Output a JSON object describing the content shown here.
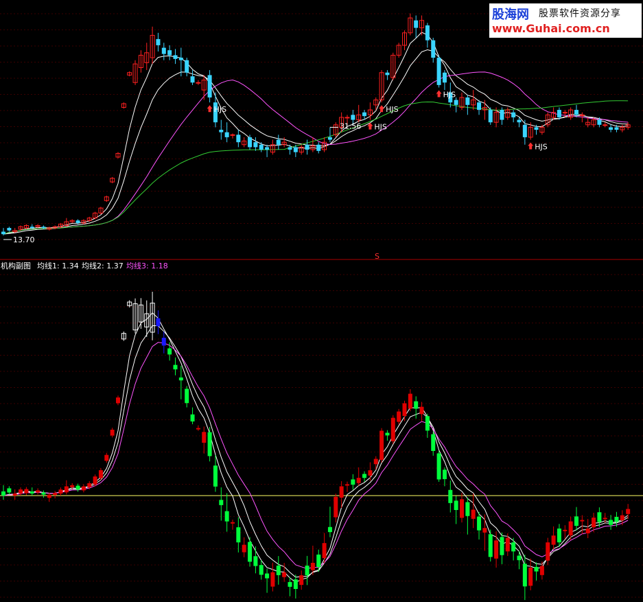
{
  "watermark": {
    "brand": "股海网",
    "slogan": "股票软件资源分享",
    "url": "www.Guhai.com.cn"
  },
  "colors": {
    "up": "#ff2020",
    "down": "#3ad4ff",
    "strong_up": "#e00000",
    "strong_down": "#00ff3c",
    "top_up": "#ffffff",
    "top_down": "#1a1aff",
    "ma1": "#ffffff",
    "ma2": "#ffffff",
    "ma3": "#ff55ff",
    "ma_long": "#33cc33",
    "divider": "#aa0000",
    "baseline": "#ffff66",
    "grid": "#7a0000",
    "text": "#ffffff"
  },
  "chart_data": [
    {
      "type": "candlestick",
      "pane": "price",
      "annotations": [
        {
          "text": "31.56",
          "x": 57,
          "kind": "high"
        },
        {
          "text": "13.70",
          "x": 0,
          "kind": "low"
        },
        {
          "text": "HJS",
          "x": 36,
          "kind": "signal"
        },
        {
          "text": "HJS",
          "x": 64,
          "kind": "signal"
        },
        {
          "text": "HJS",
          "x": 66,
          "kind": "signal"
        },
        {
          "text": "HJS",
          "x": 76,
          "kind": "signal"
        },
        {
          "text": "HJS",
          "x": 92,
          "kind": "signal"
        }
      ],
      "candles": [
        [
          14.0,
          13.8,
          14.3,
          13.7
        ],
        [
          14.3,
          14.1,
          14.4,
          14.0
        ],
        [
          14.0,
          14.1,
          14.3,
          13.9
        ],
        [
          14.2,
          14.4,
          14.5,
          14.1
        ],
        [
          14.3,
          14.5,
          14.6,
          14.2
        ],
        [
          14.4,
          14.3,
          14.6,
          14.2
        ],
        [
          14.4,
          14.5,
          14.6,
          14.3
        ],
        [
          14.4,
          14.3,
          14.5,
          14.2
        ],
        [
          14.2,
          14.3,
          14.4,
          14.1
        ],
        [
          14.3,
          14.4,
          14.5,
          14.2
        ],
        [
          14.4,
          14.6,
          14.7,
          14.3
        ],
        [
          14.5,
          14.8,
          15.1,
          14.4
        ],
        [
          14.8,
          14.9,
          15.0,
          14.7
        ],
        [
          14.9,
          14.7,
          15.0,
          14.6
        ],
        [
          14.7,
          14.9,
          15.0,
          14.6
        ],
        [
          14.9,
          15.1,
          15.2,
          14.8
        ],
        [
          15.1,
          15.5,
          15.6,
          15.0
        ],
        [
          15.5,
          15.9,
          16.0,
          15.4
        ],
        [
          16.5,
          16.8,
          16.9,
          16.4
        ],
        [
          18.0,
          18.3,
          18.4,
          17.9
        ],
        [
          20.0,
          20.3,
          20.4,
          19.9
        ],
        [
          24.0,
          24.3,
          24.4,
          23.9
        ],
        [
          26.6,
          26.8,
          26.9,
          26.5
        ],
        [
          26.0,
          27.5,
          27.8,
          25.8
        ],
        [
          27.2,
          28.2,
          28.6,
          26.8
        ],
        [
          27.6,
          28.4,
          29.2,
          27.0
        ],
        [
          28.0,
          29.8,
          30.5,
          27.5
        ],
        [
          29.5,
          29.0,
          30.0,
          28.5
        ],
        [
          28.8,
          28.3,
          29.2,
          27.8
        ],
        [
          28.6,
          28.2,
          29.0,
          27.8
        ],
        [
          28.2,
          27.9,
          28.7,
          27.5
        ],
        [
          28.0,
          27.8,
          28.8,
          26.5
        ],
        [
          27.8,
          26.8,
          28.0,
          26.5
        ],
        [
          26.5,
          26.0,
          27.0,
          25.8
        ],
        [
          26.0,
          26.0,
          26.2,
          25.8
        ],
        [
          25.4,
          26.2,
          26.6,
          24.6
        ],
        [
          26.6,
          24.8,
          27.0,
          24.4
        ],
        [
          24.4,
          22.8,
          25.2,
          22.4
        ],
        [
          22.2,
          22.0,
          23.0,
          21.4
        ],
        [
          22.0,
          21.6,
          22.8,
          21.2
        ],
        [
          21.8,
          21.8,
          21.9,
          21.5
        ],
        [
          21.8,
          21.2,
          22.2,
          20.8
        ],
        [
          21.0,
          21.3,
          21.6,
          20.8
        ],
        [
          21.6,
          20.8,
          21.8,
          20.6
        ],
        [
          21.2,
          20.8,
          21.6,
          20.5
        ],
        [
          21.0,
          20.6,
          21.2,
          20.4
        ],
        [
          20.8,
          20.6,
          21.0,
          20.0
        ],
        [
          20.4,
          21.0,
          21.4,
          20.2
        ],
        [
          21.4,
          21.0,
          21.8,
          20.6
        ],
        [
          21.0,
          21.2,
          21.6,
          20.8
        ],
        [
          20.8,
          20.6,
          21.0,
          20.2
        ],
        [
          20.8,
          20.4,
          21.0,
          20.0
        ],
        [
          20.4,
          20.8,
          21.0,
          20.2
        ],
        [
          21.0,
          20.6,
          21.4,
          20.2
        ],
        [
          20.6,
          20.9,
          21.6,
          20.4
        ],
        [
          21.0,
          20.5,
          21.2,
          20.3
        ],
        [
          20.6,
          21.2,
          21.6,
          20.4
        ],
        [
          21.6,
          21.4,
          22.4,
          21.2
        ],
        [
          21.8,
          22.6,
          22.8,
          21.6
        ],
        [
          22.4,
          23.2,
          23.6,
          22.0
        ],
        [
          23.2,
          23.2,
          23.4,
          22.6
        ],
        [
          23.4,
          23.0,
          23.8,
          22.6
        ],
        [
          23.0,
          23.4,
          24.2,
          22.8
        ],
        [
          23.6,
          23.3,
          23.8,
          23.0
        ],
        [
          23.4,
          23.8,
          24.4,
          23.0
        ],
        [
          24.2,
          24.6,
          24.8,
          23.8
        ],
        [
          24.6,
          26.8,
          27.0,
          24.4
        ],
        [
          26.8,
          26.6,
          27.0,
          26.2
        ],
        [
          26.4,
          28.2,
          28.4,
          26.2
        ],
        [
          28.2,
          29.0,
          29.2,
          28.0
        ],
        [
          29.0,
          30.0,
          30.2,
          28.6
        ],
        [
          30.0,
          31.2,
          31.56,
          29.8
        ],
        [
          31.0,
          30.4,
          31.4,
          29.6
        ],
        [
          30.4,
          31.0,
          31.4,
          29.8
        ],
        [
          30.6,
          29.4,
          30.8,
          28.8
        ],
        [
          29.4,
          28.0,
          29.6,
          27.6
        ],
        [
          28.0,
          25.8,
          28.2,
          25.6
        ],
        [
          26.8,
          26.0,
          27.0,
          25.4
        ],
        [
          25.2,
          24.4,
          26.0,
          24.0
        ],
        [
          24.6,
          24.2,
          24.8,
          23.6
        ],
        [
          24.0,
          24.8,
          25.2,
          23.8
        ],
        [
          24.8,
          24.2,
          25.0,
          23.4
        ],
        [
          24.2,
          24.6,
          25.4,
          23.8
        ],
        [
          24.4,
          23.8,
          24.6,
          23.4
        ],
        [
          23.8,
          24.0,
          24.6,
          23.0
        ],
        [
          23.8,
          22.8,
          24.0,
          22.6
        ],
        [
          22.8,
          23.6,
          24.0,
          22.4
        ],
        [
          23.8,
          23.0,
          24.0,
          22.6
        ],
        [
          23.2,
          23.8,
          24.0,
          23.0
        ],
        [
          23.6,
          23.2,
          23.8,
          22.8
        ],
        [
          23.0,
          22.8,
          23.2,
          22.4
        ],
        [
          22.6,
          21.6,
          23.0,
          21.0
        ],
        [
          21.6,
          22.4,
          22.8,
          21.4
        ],
        [
          22.4,
          22.2,
          22.6,
          21.8
        ],
        [
          22.0,
          22.4,
          22.6,
          21.8
        ],
        [
          22.6,
          23.4,
          23.6,
          22.4
        ],
        [
          23.2,
          23.6,
          24.0,
          23.0
        ],
        [
          23.8,
          23.2,
          24.0,
          23.0
        ],
        [
          23.6,
          23.6,
          23.8,
          23.2
        ],
        [
          23.2,
          23.8,
          24.0,
          23.0
        ],
        [
          23.8,
          23.4,
          24.2,
          23.2
        ],
        [
          23.4,
          23.4,
          23.6,
          22.8
        ],
        [
          22.6,
          22.8,
          23.2,
          22.4
        ],
        [
          22.6,
          23.0,
          23.2,
          22.4
        ],
        [
          23.0,
          22.6,
          23.2,
          22.4
        ],
        [
          22.6,
          22.6,
          22.8,
          22.4
        ],
        [
          22.4,
          22.2,
          22.6,
          22.0
        ],
        [
          22.4,
          22.2,
          22.6,
          22.0
        ],
        [
          22.2,
          22.4,
          22.6,
          22.0
        ],
        [
          22.4,
          22.6,
          22.8,
          22.2
        ]
      ]
    },
    {
      "type": "candlestick",
      "pane": "indicator",
      "title": "机构副图",
      "legend": [
        {
          "label": "均线1: 1.34",
          "color": "#ffffff"
        },
        {
          "label": "均线2: 1.37",
          "color": "#ffffff"
        },
        {
          "label": "均线3: 1.18",
          "color": "#ff55ff"
        }
      ],
      "series_notes": "normalized oscillator; baseline at 0"
    }
  ],
  "divider_marker": "S"
}
